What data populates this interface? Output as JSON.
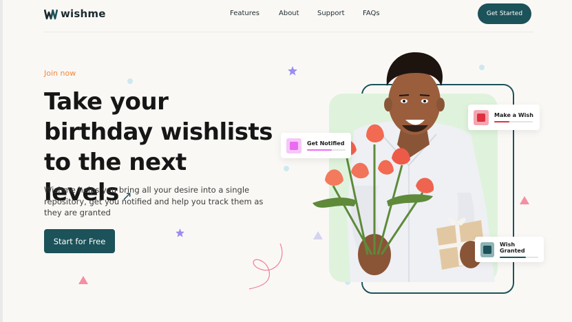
{
  "brand": {
    "name": "wishme",
    "color": "#1c5259"
  },
  "nav": {
    "items": [
      {
        "label": "Features"
      },
      {
        "label": "About"
      },
      {
        "label": "Support"
      },
      {
        "label": "FAQs"
      }
    ],
    "cta_label": "Get Started"
  },
  "hero": {
    "eyebrow": "Join now",
    "headline": "Take your birthday wishlists to the next levels",
    "headline_arrow": "↗",
    "description": "Wishme helps you bring all your desire into a single repository, get you notified and help you track them as they are granted",
    "cta_label": "Start for Free"
  },
  "cards": {
    "make_wish": {
      "label": "Make a Wish",
      "color": "#e0303f",
      "progress": 0.4
    },
    "get_notified": {
      "label": "Get Notified",
      "color": "#e96cf0",
      "progress": 0.65
    },
    "wish_granted": {
      "label": "Wish Granted",
      "color": "#1c5259",
      "progress": 0.68
    }
  },
  "colors": {
    "accent_orange": "#f0893c",
    "background": "#faf8f5",
    "panel_green": "#dff3dc"
  }
}
